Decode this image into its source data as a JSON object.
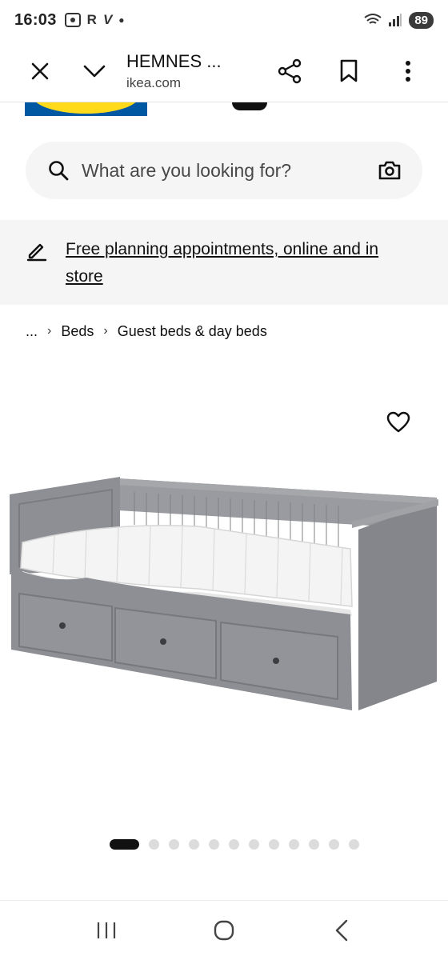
{
  "status_bar": {
    "time": "16:03",
    "left_icons": [
      "screenshot-icon",
      "r-icon",
      "v-icon",
      "dot-icon"
    ],
    "r_letter": "R",
    "v_letter": "V",
    "battery": "89"
  },
  "toolbar": {
    "title": "HEMNES ...",
    "url": "ikea.com"
  },
  "search": {
    "placeholder": "What are you looking for?"
  },
  "promo": {
    "text": "Free planning appointments, online and in store"
  },
  "breadcrumb": {
    "ellipsis": "...",
    "items": [
      "Beds",
      "Guest beds & day beds"
    ]
  },
  "carousel": {
    "total": 12,
    "active_index": 0
  },
  "colors": {
    "ikea_blue": "#0058a3",
    "ikea_yellow": "#ffda1a",
    "bed_grey": "#8e8f94"
  }
}
